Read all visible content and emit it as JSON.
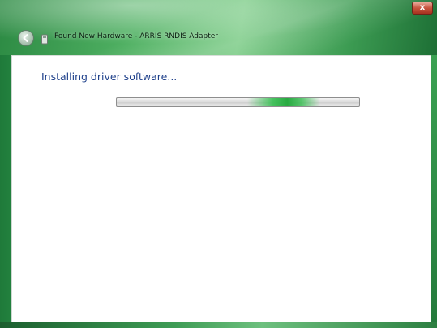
{
  "window": {
    "title": "Found New Hardware - ARRIS RNDIS Adapter",
    "close_label": "x",
    "accent_color": "#3a9e54"
  },
  "icons": {
    "back": "back-arrow-icon",
    "device": "hardware-device-icon"
  },
  "content": {
    "heading": "Installing driver software...",
    "progress": {
      "mode": "indeterminate",
      "indicator_position_fraction": 0.69,
      "color": "#2fae4d"
    }
  }
}
